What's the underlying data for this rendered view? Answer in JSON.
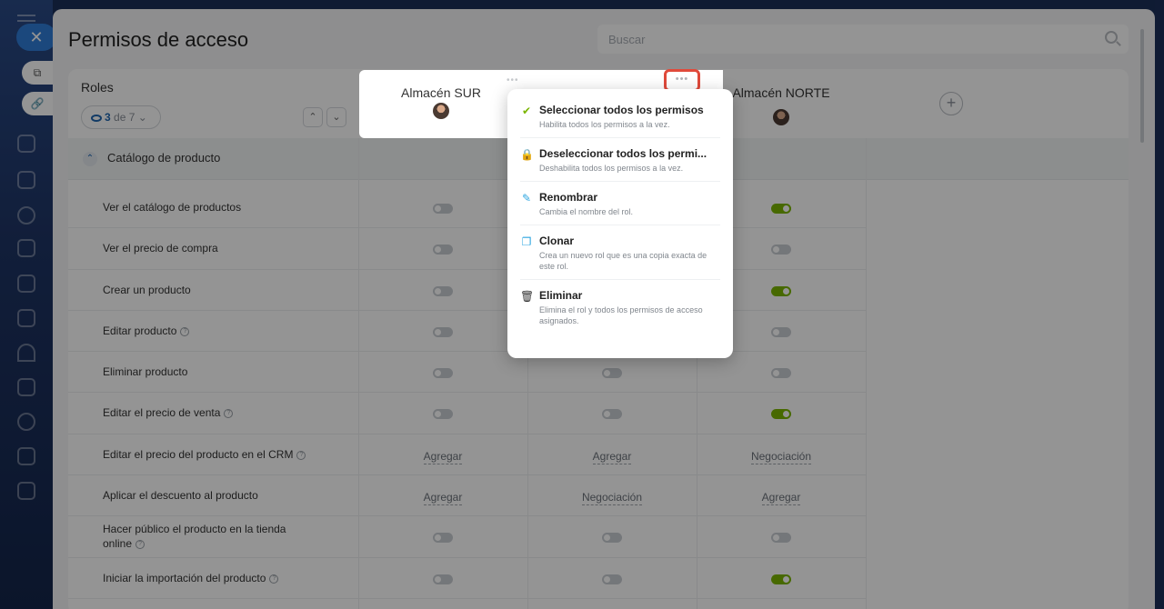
{
  "page": {
    "title": "Permisos de acceso",
    "search_placeholder": "Buscar"
  },
  "roles_header": {
    "label": "Roles",
    "visible_count": "3",
    "total_text": "de 7"
  },
  "role_columns": [
    {
      "name": "Almacén SUR"
    },
    {
      "name": ""
    },
    {
      "name": "Almacén NORTE"
    }
  ],
  "section": {
    "label": "Catálogo de producto"
  },
  "rows": [
    {
      "label": "Ver el catálogo de productos",
      "help": false,
      "values": [
        "off",
        "hidden",
        "on"
      ]
    },
    {
      "label": "Ver el precio de compra",
      "help": false,
      "values": [
        "off",
        "hidden",
        "off"
      ]
    },
    {
      "label": "Crear un producto",
      "help": false,
      "values": [
        "off",
        "hidden",
        "on"
      ]
    },
    {
      "label": "Editar producto",
      "help": true,
      "values": [
        "off",
        "hidden",
        "off"
      ]
    },
    {
      "label": "Eliminar producto",
      "help": false,
      "values": [
        "off",
        "off",
        "off"
      ]
    },
    {
      "label": "Editar el precio de venta",
      "help": true,
      "values": [
        "off",
        "off",
        "on"
      ]
    },
    {
      "label": "Editar el precio del producto en el CRM",
      "help": true,
      "values": [
        "Agregar",
        "Agregar",
        "Negociación"
      ]
    },
    {
      "label": "Aplicar el descuento al producto",
      "help": false,
      "values": [
        "Agregar",
        "Negociación",
        "Agregar"
      ]
    },
    {
      "label": "Hacer público el producto en la tienda online",
      "help": true,
      "values": [
        "off",
        "off",
        "off"
      ]
    },
    {
      "label": "Iniciar la importación del producto",
      "help": true,
      "values": [
        "off",
        "off",
        "on"
      ]
    }
  ],
  "menu": {
    "items": [
      {
        "title": "Seleccionar todos los permisos",
        "desc": "Habilita todos los permisos a la vez.",
        "icon": "check-icon",
        "color": "#7ab500"
      },
      {
        "title": "Deseleccionar todos los permi...",
        "desc": "Deshabilita todos los permisos a la vez.",
        "icon": "lock-icon",
        "color": "#e5383b"
      },
      {
        "title": "Renombrar",
        "desc": "Cambia el nombre del rol.",
        "icon": "pencil-icon",
        "color": "#2fa6e0"
      },
      {
        "title": "Clonar",
        "desc": "Crea un nuevo rol que es una copia exacta de este rol.",
        "icon": "copy-icon",
        "color": "#2fa6e0"
      },
      {
        "title": "Eliminar",
        "desc": "Elimina el rol y todos los permisos de acceso asignados.",
        "icon": "trash-icon",
        "color": "#333333"
      }
    ]
  },
  "colors": {
    "toggle_on": "#7ab500",
    "toggle_off": "#c9cdd2",
    "highlight": "#e04a3b",
    "accent": "#2067b0"
  }
}
